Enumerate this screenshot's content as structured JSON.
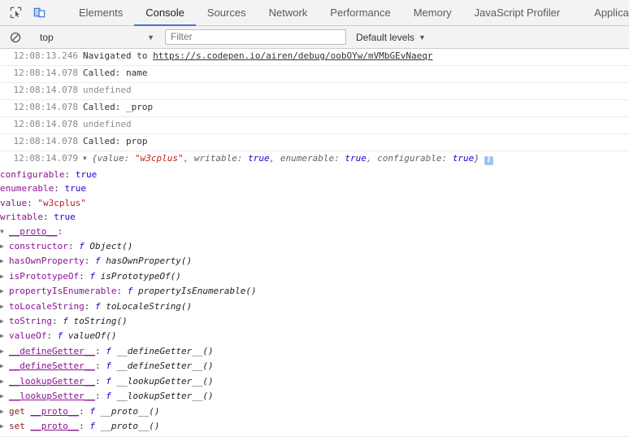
{
  "devtools": {
    "toolbar_icons": [
      {
        "name": "inspect-element-icon",
        "label": "Inspect element"
      },
      {
        "name": "device-toolbar-icon",
        "label": "Toggle device toolbar"
      }
    ],
    "tabs": [
      {
        "label": "Elements",
        "active": false
      },
      {
        "label": "Console",
        "active": true
      },
      {
        "label": "Sources",
        "active": false
      },
      {
        "label": "Network",
        "active": false
      },
      {
        "label": "Performance",
        "active": false
      },
      {
        "label": "Memory",
        "active": false
      },
      {
        "label": "JavaScript Profiler",
        "active": false
      },
      {
        "label": "Application",
        "active": false
      }
    ],
    "active_tab_underline_color": "#3879d9"
  },
  "filterbar": {
    "clear_icon": "clear-console-icon",
    "context": "top",
    "context_caret": "▼",
    "filter_placeholder": "Filter",
    "filter_value": "",
    "levels_label": "Default levels",
    "levels_caret": "▼"
  },
  "console": {
    "entries": [
      {
        "timestamp": "12:08:13.246",
        "prefix": "Navigated to ",
        "link": "https://s.codepen.io/airen/debug/oobOYw/mVMbGEvNaeqr"
      },
      {
        "timestamp": "12:08:14.078",
        "text": "Called: name"
      },
      {
        "timestamp": "12:08:14.078",
        "text": "undefined",
        "dim": true
      },
      {
        "timestamp": "12:08:14.078",
        "text": "Called: _prop"
      },
      {
        "timestamp": "12:08:14.078",
        "text": "undefined",
        "dim": true
      },
      {
        "timestamp": "12:08:14.078",
        "text": "Called: prop"
      }
    ],
    "object_entry": {
      "timestamp": "12:08:14.079",
      "expand_triangle": "▼",
      "summary": {
        "open_brace": "{",
        "close_brace": "}",
        "parts": [
          {
            "key": "value",
            "value": "\"w3cplus\"",
            "type": "string"
          },
          {
            "key": "writable",
            "value": "true",
            "type": "bool"
          },
          {
            "key": "enumerable",
            "value": "true",
            "type": "bool"
          },
          {
            "key": "configurable",
            "value": "true",
            "type": "bool"
          }
        ],
        "info_badge": "i"
      },
      "properties": [
        {
          "key": "configurable",
          "value": "true",
          "type": "bool"
        },
        {
          "key": "enumerable",
          "value": "true",
          "type": "bool"
        },
        {
          "key": "value",
          "value": "\"w3cplus\"",
          "type": "string"
        },
        {
          "key": "writable",
          "value": "true",
          "type": "bool"
        }
      ],
      "proto": {
        "triangle": "▼",
        "label": "__proto__",
        "members": [
          {
            "triangle": "▶",
            "key": "constructor",
            "fn_kw": "f",
            "fn": "Object()"
          },
          {
            "triangle": "▶",
            "key": "hasOwnProperty",
            "fn_kw": "f",
            "fn": "hasOwnProperty()"
          },
          {
            "triangle": "▶",
            "key": "isPrototypeOf",
            "fn_kw": "f",
            "fn": "isPrototypeOf()"
          },
          {
            "triangle": "▶",
            "key": "propertyIsEnumerable",
            "fn_kw": "f",
            "fn": "propertyIsEnumerable()"
          },
          {
            "triangle": "▶",
            "key": "toLocaleString",
            "fn_kw": "f",
            "fn": "toLocaleString()"
          },
          {
            "triangle": "▶",
            "key": "toString",
            "fn_kw": "f",
            "fn": "toString()"
          },
          {
            "triangle": "▶",
            "key": "valueOf",
            "fn_kw": "f",
            "fn": "valueOf()"
          },
          {
            "triangle": "▶",
            "key": "__defineGetter__",
            "fn_kw": "f",
            "fn": "__defineGetter__()",
            "underline": true
          },
          {
            "triangle": "▶",
            "key": "__defineSetter__",
            "fn_kw": "f",
            "fn": "__defineSetter__()",
            "underline": true
          },
          {
            "triangle": "▶",
            "key": "__lookupGetter__",
            "fn_kw": "f",
            "fn": "__lookupGetter__()",
            "underline": true
          },
          {
            "triangle": "▶",
            "key": "__lookupSetter__",
            "fn_kw": "f",
            "fn": "__lookupSetter__()",
            "underline": true
          },
          {
            "triangle": "▶",
            "accessor": "get",
            "key": "__proto__",
            "fn_kw": "f",
            "fn": "__proto__()",
            "underline": true
          },
          {
            "triangle": "▶",
            "accessor": "set",
            "key": "__proto__",
            "fn_kw": "f",
            "fn": "__proto__()",
            "underline": true
          }
        ]
      }
    }
  },
  "colors": {
    "accent": "#3879d9",
    "string": "#c41a16",
    "boolean": "#1c00cf",
    "property": "#881391",
    "accessor": "#8b2020",
    "timestamp": "#888888"
  }
}
